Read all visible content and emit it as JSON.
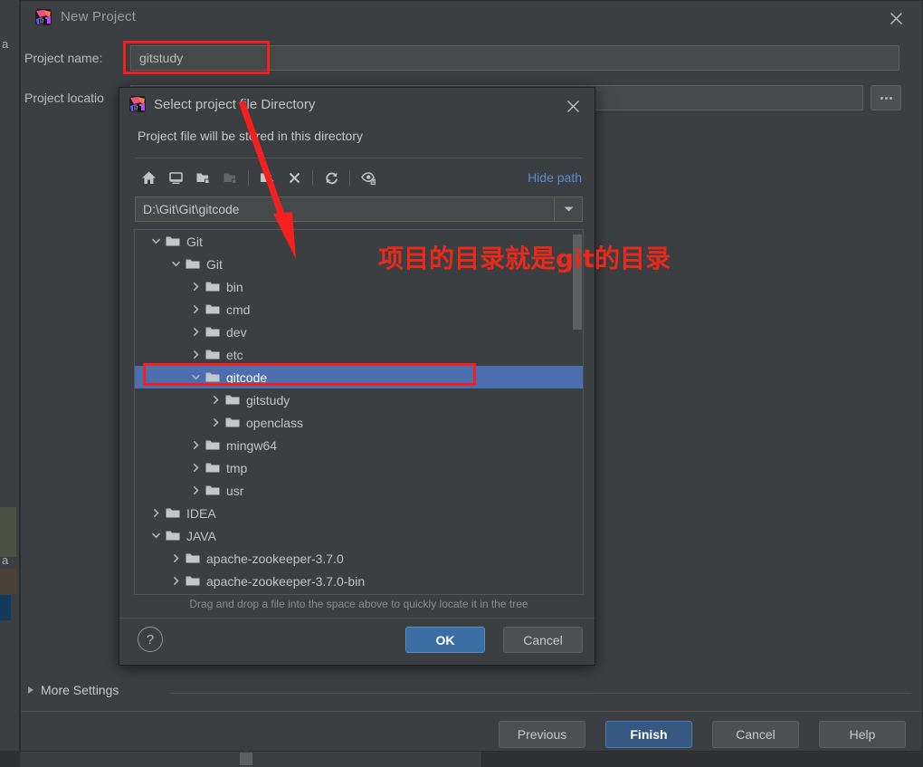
{
  "background_ide": {
    "edge_letters": [
      "a",
      "a"
    ]
  },
  "new_project_dialog": {
    "title": "New Project",
    "app_icon": "intellij-idea-icon",
    "close_icon": "close-icon",
    "project_name_label": "Project name:",
    "project_name_value": "gitstudy",
    "project_name_placeholder": "",
    "project_location_label": "Project locatio",
    "project_location_value": "",
    "project_location_placeholder": "",
    "browse_button_label": "...",
    "more_settings_label": "More Settings",
    "buttons": [
      {
        "label": "Previous",
        "style": "normal"
      },
      {
        "label": "Finish",
        "style": "primary"
      },
      {
        "label": "Cancel",
        "style": "normal"
      },
      {
        "label": "Help",
        "style": "normal"
      }
    ]
  },
  "select_directory_dialog": {
    "title": "Select project file Directory",
    "app_icon": "intellij-idea-icon",
    "close_icon": "close-icon",
    "subtitle": "Project file will be stored in this directory",
    "toolbar": {
      "items": [
        {
          "icon": "home-icon",
          "tooltip": "Home",
          "disabled": false
        },
        {
          "icon": "desktop-icon",
          "tooltip": "Desktop",
          "disabled": false
        },
        {
          "icon": "folder-project-icon",
          "tooltip": "Project",
          "disabled": false
        },
        {
          "icon": "folder-module-icon",
          "tooltip": "Module",
          "disabled": true
        },
        {
          "icon": "new-folder-icon",
          "tooltip": "New Folder",
          "disabled": false
        },
        {
          "icon": "delete-icon",
          "tooltip": "Delete",
          "disabled": false
        },
        {
          "icon": "refresh-icon",
          "tooltip": "Refresh",
          "disabled": false
        },
        {
          "icon": "show-hidden-files-icon",
          "tooltip": "Show Hidden Files",
          "disabled": false
        }
      ],
      "hide_path_label": "Hide path"
    },
    "path_field": {
      "value": "D:\\Git\\Git\\gitcode",
      "placeholder": "",
      "dropdown_icon": "chevron-down-icon"
    },
    "tree": {
      "rows": [
        {
          "label": "Git",
          "depth": 1,
          "twisty": "expanded",
          "selected": false
        },
        {
          "label": "Git",
          "depth": 2,
          "twisty": "expanded",
          "selected": false
        },
        {
          "label": "bin",
          "depth": 3,
          "twisty": "collapsed",
          "selected": false
        },
        {
          "label": "cmd",
          "depth": 3,
          "twisty": "collapsed",
          "selected": false
        },
        {
          "label": "dev",
          "depth": 3,
          "twisty": "collapsed",
          "selected": false
        },
        {
          "label": "etc",
          "depth": 3,
          "twisty": "collapsed",
          "selected": false
        },
        {
          "label": "gitcode",
          "depth": 3,
          "twisty": "expanded",
          "selected": true
        },
        {
          "label": "gitstudy",
          "depth": 4,
          "twisty": "collapsed",
          "selected": false
        },
        {
          "label": "openclass",
          "depth": 4,
          "twisty": "collapsed",
          "selected": false
        },
        {
          "label": "mingw64",
          "depth": 3,
          "twisty": "collapsed",
          "selected": false
        },
        {
          "label": "tmp",
          "depth": 3,
          "twisty": "collapsed",
          "selected": false
        },
        {
          "label": "usr",
          "depth": 3,
          "twisty": "collapsed",
          "selected": false
        },
        {
          "label": "IDEA",
          "depth": 1,
          "twisty": "collapsed",
          "selected": false
        },
        {
          "label": "JAVA",
          "depth": 1,
          "twisty": "expanded",
          "selected": false
        },
        {
          "label": "apache-zookeeper-3.7.0",
          "depth": 2,
          "twisty": "collapsed",
          "selected": false
        },
        {
          "label": "apache-zookeeper-3.7.0-bin",
          "depth": 2,
          "twisty": "collapsed",
          "selected": false
        }
      ],
      "folder_icon": "folder-icon",
      "expanded_icon": "chevron-down-icon",
      "collapsed_icon": "chevron-right-icon"
    },
    "hint": "Drag and drop a file into the space above to quickly locate it in the tree",
    "help_button_label": "?",
    "buttons": [
      {
        "label": "OK",
        "style": "primary"
      },
      {
        "label": "Cancel",
        "style": "normal"
      }
    ]
  },
  "annotations": {
    "note_text": "项目的目录就是git的目录",
    "color": "#e82a1c",
    "boxes": [
      {
        "name": "project-name-highlight"
      },
      {
        "name": "gitcode-row-highlight"
      }
    ],
    "arrow": {
      "name": "pointer-arrow",
      "from": "project-name-field",
      "to": "gitcode-tree-row"
    }
  },
  "colors": {
    "accent_blue": "#4b6eaf",
    "primary_button": "#365880",
    "link_blue": "#5a8ad6",
    "panel_bg": "#3c3f41",
    "input_bg": "#45494a",
    "annotation_red": "#e82a1c"
  }
}
